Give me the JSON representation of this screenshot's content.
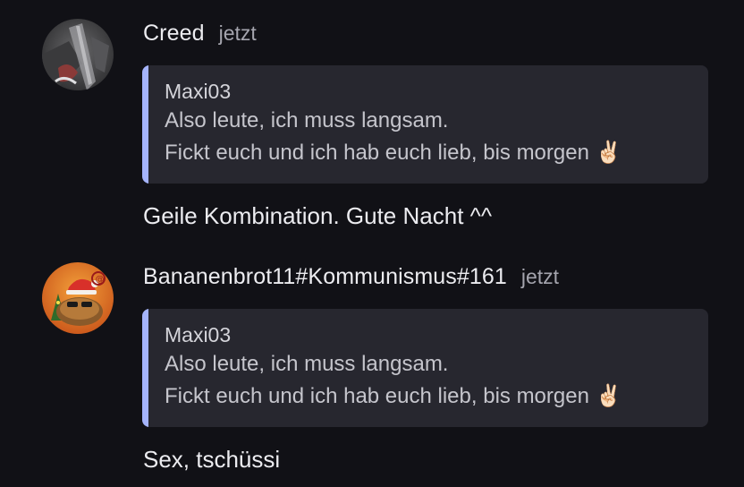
{
  "messages": [
    {
      "username": "Creed",
      "timestamp": "jetzt",
      "avatar_icon": "avatar-creed-icon",
      "quote": {
        "author": "Maxi03",
        "line1": "Also leute, ich muss langsam.",
        "line2": "Fickt euch und ich hab euch lieb, bis morgen ✌🏻"
      },
      "text": "Geile Kombination. Gute Nacht ^^"
    },
    {
      "username": "Bananenbrot11#Kommunismus#161",
      "timestamp": "jetzt",
      "avatar_icon": "avatar-bananenbrot-icon",
      "quote": {
        "author": "Maxi03",
        "line1": "Also leute, ich muss langsam.",
        "line2": "Fickt euch und ich hab euch lieb, bis morgen ✌🏻"
      },
      "text": "Sex, tschüssi"
    }
  ],
  "colors": {
    "background": "#111116",
    "quote_background": "#27272f",
    "quote_accent": "#a5b4fc",
    "timestamp": "#a4a4ad"
  }
}
